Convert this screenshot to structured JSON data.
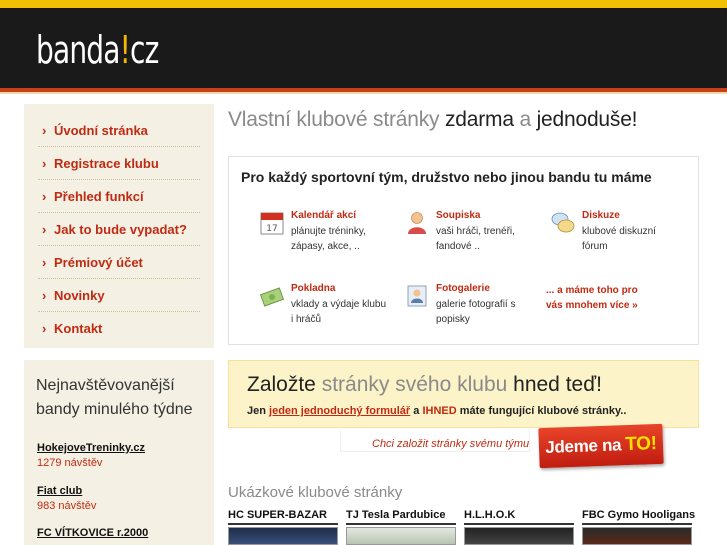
{
  "logo": {
    "prefix": "banda",
    "bang": "!",
    "suffix": "cz"
  },
  "nav": [
    "Úvodní stránka",
    "Registrace klubu",
    "Přehled funkcí",
    "Jak to bude vypadat?",
    "Prémiový účet",
    "Novinky",
    "Kontakt"
  ],
  "popular": {
    "title": "Nejnavštěvovanější bandy minulého týdne",
    "items": [
      {
        "name": "HokejoveTreninky.cz",
        "visits": "1279 návštěv"
      },
      {
        "name": "Fiat club",
        "visits": "983 návštěv"
      },
      {
        "name": "FC VÍTKOVICE r.2000",
        "visits": ""
      }
    ]
  },
  "main": {
    "title_a": "Vlastní klubové stránky ",
    "title_b": "zdarma",
    "title_c": " a ",
    "title_d": "jednoduše!"
  },
  "features": {
    "heading": "Pro každý sportovní tým, družstvo nebo jinou bandu tu máme",
    "items": [
      {
        "title": "Kalendář akcí",
        "desc": "plánujte tréninky, zápasy, akce, ..",
        "icon": "calendar-icon"
      },
      {
        "title": "Soupiska",
        "desc": "vaši hráči, trenéři, fandové ..",
        "icon": "person-icon"
      },
      {
        "title": "Diskuze",
        "desc": "klubové diskuzní fórum",
        "icon": "discussion-icon"
      },
      {
        "title": "Pokladna",
        "desc": "vklady a výdaje klubu i hráčů",
        "icon": "money-icon"
      },
      {
        "title": "Fotogalerie",
        "desc": "galerie fotografií s popisky",
        "icon": "photo-icon"
      }
    ],
    "more": "... a máme toho pro vás mnohem více »"
  },
  "cta": {
    "title_a": "Založte ",
    "title_b": "stránky svého klubu",
    "title_c": " hned teď!",
    "sub_a": "Jen ",
    "sub_link": "jeden jednoduchý formulář",
    "sub_b": " a ",
    "sub_red": "IHNED",
    "sub_c": " máte fungující klubové stránky..",
    "row_text": "Chci založit stránky svému týmu",
    "button_a": "Jdeme na",
    "button_b": "TO!"
  },
  "samples": {
    "title": "Ukázkové klubové stránky",
    "items": [
      "HC SUPER-BAZAR",
      "TJ Tesla Pardubice",
      "H.L.H.O.K",
      "FBC Gymo Hooligans"
    ]
  },
  "colors": {
    "accent": "#c12a12",
    "header": "#1a1a1a",
    "yellow": "#f2c200",
    "sidebar": "#f4f1e4",
    "cta_bg": "#fdf3c8"
  }
}
